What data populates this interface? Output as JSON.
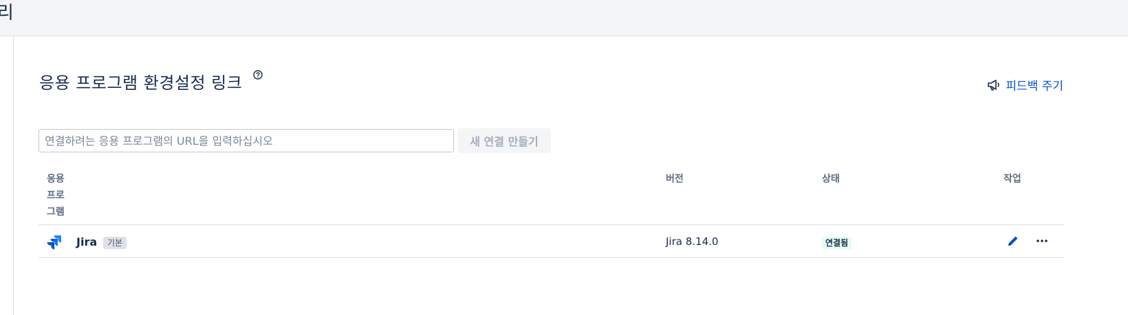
{
  "header": {
    "truncated_title": "리"
  },
  "page": {
    "title": "응용 프로그램 환경설정 링크",
    "help_icon": "question-circle-icon",
    "feedback_label": "피드백 주기",
    "feedback_icon": "megaphone-icon"
  },
  "create": {
    "placeholder": "연결하려는 응용 프로그램의 URL을 입력하십시오",
    "value": "",
    "button_label": "새 연결 만들기"
  },
  "table": {
    "headers": {
      "application_lines": [
        "응용",
        "프로",
        "그램"
      ],
      "version": "버전",
      "status": "상태",
      "actions": "작업"
    },
    "rows": [
      {
        "icon": "jira-logo-icon",
        "name": "Jira",
        "badge": "기본",
        "version": "Jira 8.14.0",
        "status": "연결됨",
        "status_color": "#e3fcef",
        "actions": [
          "pencil-icon",
          "more-horizontal-icon"
        ]
      }
    ]
  },
  "colors": {
    "accent": "#0052cc",
    "text": "#172b4d",
    "muted": "#5e6c84",
    "topbar": "#f4f5f7"
  }
}
